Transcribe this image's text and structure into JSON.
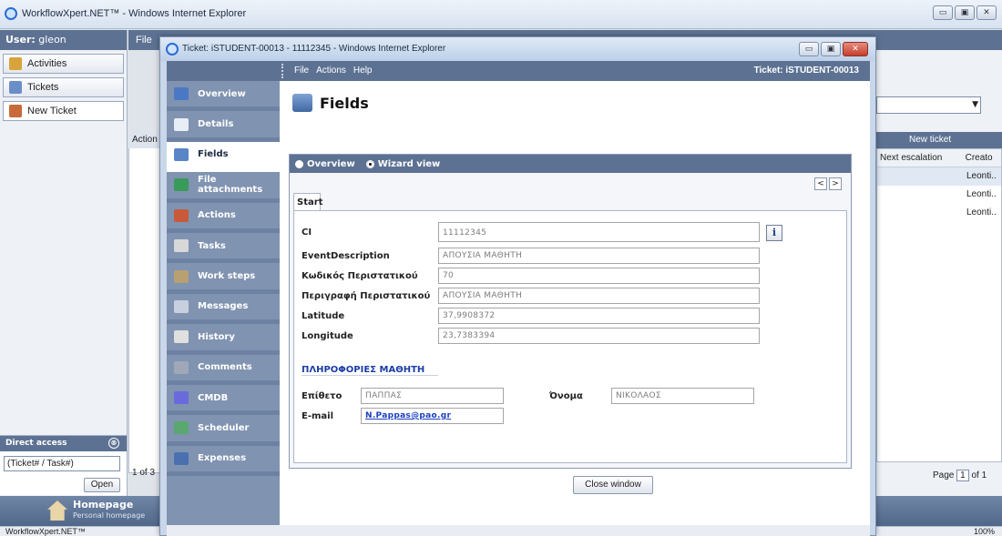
{
  "outer_window": {
    "title": "WorkflowXpert.NET™ - Windows Internet Explorer",
    "min": "▭",
    "max": "▣",
    "close": "✕"
  },
  "left": {
    "user_label": "User:",
    "user_name": "gleon",
    "nav": [
      {
        "label": "Activities",
        "icon_color": "#d8a43a"
      },
      {
        "label": "Tickets",
        "icon_color": "#6a8fc8"
      },
      {
        "label": "New Ticket",
        "icon_color": "#c86a3a"
      }
    ],
    "direct_access_title": "Direct access",
    "direct_access_collapse": "⊗",
    "direct_access_value": "(Ticket# / Task#)",
    "open_label": "Open",
    "homepage_title": "Homepage",
    "homepage_sub": "Personal homepage"
  },
  "main": {
    "file_menu": "File",
    "grid_header": "Action",
    "pager": "1 of 3",
    "right_toolbar": "New ticket",
    "right_headers": [
      "Next escalation",
      "Creato"
    ],
    "right_rows": [
      "Leonti..",
      "Leonti..",
      "Leonti.."
    ],
    "right_pager_prefix": "Page",
    "right_pager_num": "1",
    "right_pager_suffix": "of 1"
  },
  "status": {
    "text": "WorkflowXpert.NET™",
    "zoom": "100%"
  },
  "popup": {
    "title": "Ticket: iSTUDENT-00013 - 11112345 - Windows Internet Explorer",
    "menu": [
      "File",
      "Actions",
      "Help"
    ],
    "ticket_label": "Ticket: iSTUDENT-00013",
    "nav": [
      {
        "label": "Overview",
        "icon_color": "#4a78c4"
      },
      {
        "label": "Details",
        "icon_color": "#e8eef6"
      },
      {
        "label": "Fields",
        "icon_color": "#5a86c8"
      },
      {
        "label": "File attachments",
        "icon_color": "#3a9a5a"
      },
      {
        "label": "Actions",
        "icon_color": "#c85a3a"
      },
      {
        "label": "Tasks",
        "icon_color": "#d8d8d8"
      },
      {
        "label": "Work steps",
        "icon_color": "#b8a070"
      },
      {
        "label": "Messages",
        "icon_color": "#c8d0e0"
      },
      {
        "label": "History",
        "icon_color": "#e0e0e0"
      },
      {
        "label": "Comments",
        "icon_color": "#a0a8b8"
      },
      {
        "label": "CMDB",
        "icon_color": "#6a6adc"
      },
      {
        "label": "Scheduler",
        "icon_color": "#5aa870"
      },
      {
        "label": "Expenses",
        "icon_color": "#4a70b0"
      }
    ],
    "page_title": "Fields",
    "view_overview": "Overview",
    "view_wizard": "Wizard view",
    "prev": "<",
    "next": ">",
    "tab_start": "Start",
    "fields": {
      "ci_label": "CI",
      "ci_value": "11112345",
      "info": "i",
      "event_label": "EventDescription",
      "event_value": "ΑΠΟΥΣΙΑ ΜΑΘΗΤΗ",
      "code_label": "Κωδικός Περιστατικού",
      "code_value": "70",
      "desc_label": "Περιγραφή Περιστατικού",
      "desc_value": "ΑΠΟΥΣΙΑ ΜΑΘΗΤΗ",
      "lat_label": "Latitude",
      "lat_value": "37,9908372",
      "lon_label": "Longitude",
      "lon_value": "23,7383394"
    },
    "section_title": "ΠΛΗΡΟΦΟΡΙΕΣ ΜΑΘΗΤΗ",
    "student": {
      "surname_label": "Επίθετο",
      "surname_value": "ΠΑΠΠΑΣ",
      "name_label": "Όνομα",
      "name_value": "ΝΙΚΟΛΑΟΣ",
      "email_label": "E-mail",
      "email_value": "N.Pappas@pao.gr"
    },
    "close_window": "Close window"
  }
}
